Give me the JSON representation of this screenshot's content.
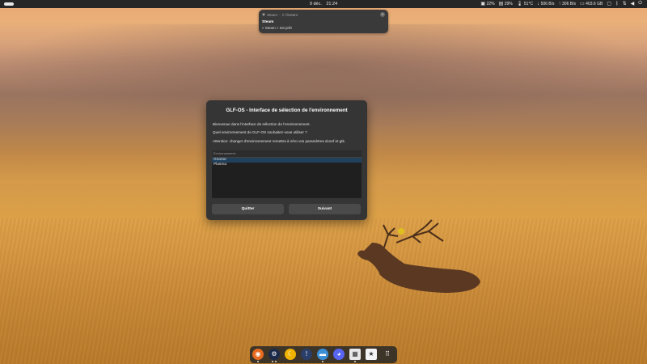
{
  "topbar": {
    "clock_date": "9 déc.",
    "clock_time": "21:24",
    "indicators": [
      {
        "icon": "cpu-icon",
        "text": "22%"
      },
      {
        "icon": "memory-icon",
        "text": "29%"
      },
      {
        "icon": "thermometer-icon",
        "text": "51°C"
      },
      {
        "icon": "download-icon",
        "text": "506 B/s"
      },
      {
        "icon": "upload-icon",
        "text": "306 B/s"
      },
      {
        "icon": "disk-icon",
        "text": "403.6 GB"
      }
    ]
  },
  "notification": {
    "app": "Steam",
    "time": "À l'instant",
    "title": "Steam",
    "body": "« Steam » est prêt"
  },
  "dialog": {
    "title": "GLF-OS - Interface de sélection de l'environnement",
    "line1": "Bienvenue dans l'interface de sélection de l'environnement.",
    "line2": "Quel environnement de GLF-OS souhaitez-vous utiliser ?",
    "line3": "Attention: changer d'environnement remettra à zéro vos paramètres dconf et gtk.",
    "list_header": "Environnement",
    "options": [
      "Gnome",
      "Plasma"
    ],
    "selected": "Gnome",
    "quit_label": "Quitter",
    "next_label": "Suivant"
  },
  "dock": {
    "apps": [
      "firefox-icon",
      "steam-icon",
      "heroic-launcher-icon",
      "lutris-icon",
      "files-icon",
      "discord-icon",
      "document-viewer-icon",
      "software-store-icon",
      "app-grid-icon"
    ]
  }
}
